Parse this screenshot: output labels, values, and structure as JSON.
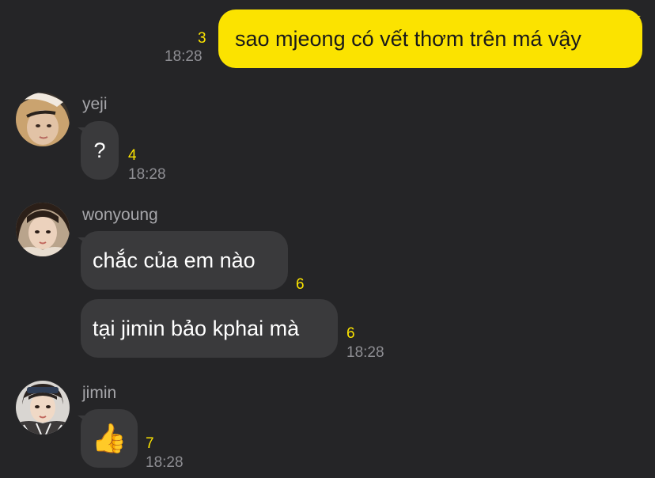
{
  "messages": [
    {
      "text": "sao mjeong có vết thơm trên má vậy",
      "unread": "3",
      "time": "18:28"
    },
    {
      "sender": "yeji",
      "text": "?",
      "unread": "4",
      "time": "18:28"
    },
    {
      "sender": "wonyoung",
      "text": "chắc của em nào",
      "unread": "6"
    },
    {
      "text": "tại jimin bảo kphai mà",
      "unread": "6",
      "time": "18:28"
    },
    {
      "sender": "jimin",
      "text": "👍",
      "unread": "7",
      "time": "18:28"
    }
  ],
  "colors": {
    "background": "#252527",
    "my_bubble": "#fbe300",
    "other_bubble": "#3a3a3c",
    "unread_count": "#fbe300",
    "timestamp": "#8e8e93"
  },
  "icons": {
    "reaction": "thumbs-up-emoji"
  }
}
